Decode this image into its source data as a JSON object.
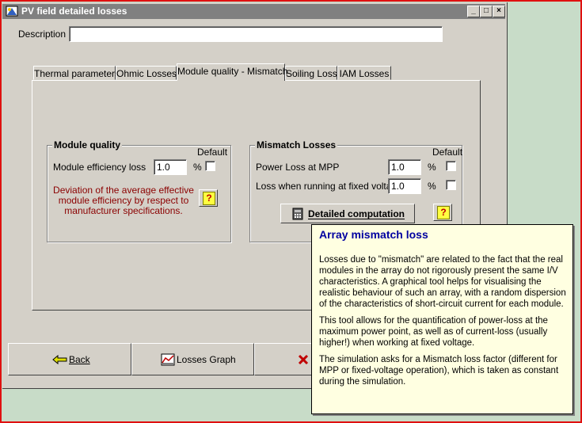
{
  "window": {
    "title": "PV field detailed losses",
    "minimize": "_",
    "maximize": "□",
    "close": "×"
  },
  "description": {
    "label": "Description",
    "value": ""
  },
  "tabs": [
    {
      "label": "Thermal parameters"
    },
    {
      "label": "Ohmic Losses"
    },
    {
      "label": "Module quality - Mismatch"
    },
    {
      "label": "Soiling Loss"
    },
    {
      "label": "IAM Losses"
    }
  ],
  "module_quality": {
    "title": "Module quality",
    "default_label": "Default",
    "efficiency_label": "Module efficiency loss",
    "efficiency_value": "1.0",
    "unit": "%",
    "note": "Deviation of the average effective module efficiency by respect to manufacturer specifications.",
    "help": "?"
  },
  "mismatch": {
    "title": "Mismatch Losses",
    "default_label": "Default",
    "mpp_label": "Power Loss at MPP",
    "mpp_value": "1.0",
    "fixed_label": "Loss when running at fixed voltage",
    "fixed_value": "1.0",
    "unit": "%",
    "detailed_button": "Detailed computation",
    "help": "?"
  },
  "bottom": {
    "back": "Back",
    "graph": "Losses Graph"
  },
  "tooltip": {
    "title": "Array mismatch loss",
    "p1": "Losses due to \"mismatch\" are related to the fact that the real modules in the array do not rigorously present the same I/V characteristics. A graphical tool helps for visualising the realistic behaviour of such an array, with a random dispersion of the characteristics of short-circuit current for each module.",
    "p2": "This tool allows for the quantification of power-loss at the maximum power point, as well as of current-loss (usually higher!) when working at fixed voltage.",
    "p3": "The simulation asks for a Mismatch loss factor (different for MPP or fixed-voltage operation), which is taken as constant during the simulation."
  }
}
